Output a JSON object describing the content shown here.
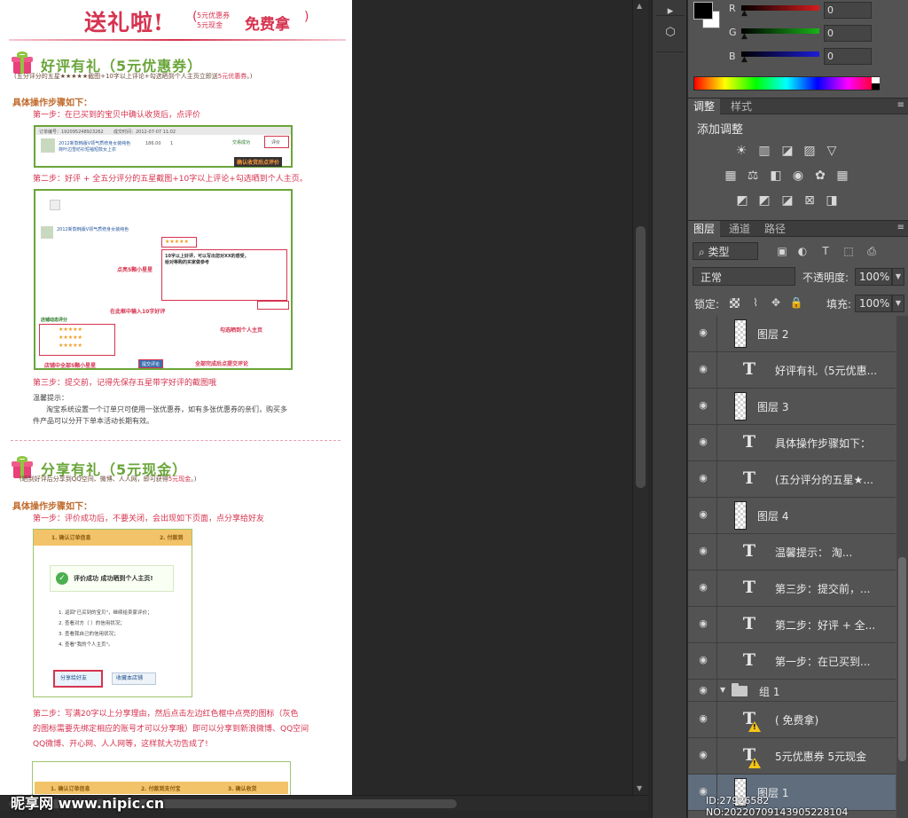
{
  "doc": {
    "header": {
      "title": "送礼啦!",
      "sub1": "5元优惠券",
      "sub2": "5元现金",
      "free": "免费拿",
      "paren_open": "(",
      "paren_close": ")"
    },
    "section1": {
      "title": "好评有礼（5元优惠券）",
      "note_a": "(五分评分的五星★★★★★截图+10字以上评论+勾选晒到个人主页立即送",
      "note_hl": "5元优惠券",
      "note_b": "。)",
      "steps_heading": "具体操作步骤如下：",
      "step1": "第一步：在已买到的宝贝中确认收货后，点评价",
      "step2": "第二步：好评 + 全五分评分的五星截图+10字以上评论+勾选晒到个人主页。",
      "step3": "第三步：提交前，记得先保存五星带字好评的截图哦",
      "tip_head": "温馨提示：",
      "tip_body1": "淘宝系统设置一个订单只可使用一张优惠券，如有多张优惠券的亲们，购买多",
      "tip_body2": "件产品可以分开下单本活动长期有效。"
    },
    "shot1": {
      "order_no": "订单编号：192095248923262",
      "deal_time": "成交时间：2012-07-07 11:02",
      "item": "2012新款韩版V领气质修身女装纯色",
      "item2": "荷叶边雪纺衫短袖短款女上衣",
      "price": "186.00",
      "qty": "1",
      "status": "交易成功",
      "rate_btn": "评价",
      "callout": "确认收货后点评价"
    },
    "shot2": {
      "callout_stars": "点亮5颗小星星",
      "callout_box": "在此框中输入10字好评",
      "callout_check": "勾选晒到个人主页",
      "callout_shop": "店铺中全部5颗小星星",
      "callout_submit": "全部完成后点提交评论",
      "review_text": "10字以上好评，可以写出您对XX的感受，",
      "review_text2": "给对等购的买家做参考",
      "submit_btn": "提交评论",
      "shop_rating": "店铺动态评分"
    },
    "section2": {
      "title": "分享有礼（5元现金）",
      "note_a": "(晒到好评后分享到QQ空间、微博、人人网，即可获得",
      "note_hl": "5元现金",
      "note_b": "。)",
      "steps_heading": "具体操作步骤如下：",
      "step1": "第一步：评价成功后，不要关闭，会出现如下页面，点分享给好友",
      "step2_l1": "第二步：写满20字以上分享理由，然后点击左边红色框中点亮的图标（灰色",
      "step2_l2": "的图标需要先绑定相应的账号才可以分享哦）即可以分享到新浪微博、QQ空间",
      "step2_l3": "QQ微博、开心网、人人网等，这样就大功告成了!"
    },
    "shot_share": {
      "bar1": "1. 确认订单信息",
      "bar2": "2. 付款到",
      "ok": "评价成功 成功晒到个人主页!",
      "list1": "1. 返回\"已买到的宝贝\"，继续给卖家评价；",
      "list2": "2. 查看对方（                ）的信用状况；",
      "list3": "3. 查看我自己的信用状况；",
      "list4": "4. 查看\"我的个人主页\"。",
      "share_btn": "分享给好友",
      "fav_btn": "收藏本店铺"
    },
    "shot3": {
      "bar1": "1. 确认订单信息",
      "bar2": "2. 付款到支付宝",
      "bar3": "3. 确认收货"
    }
  },
  "strip": {
    "icon1": "▸",
    "icon2": "⬡"
  },
  "color_panel": {
    "channels": [
      {
        "label": "R",
        "value": "0"
      },
      {
        "label": "G",
        "value": "0"
      },
      {
        "label": "B",
        "value": "0"
      }
    ],
    "colors": {
      "r": "#d81b1b",
      "g": "#18b418",
      "b": "#1c1cd6"
    }
  },
  "adjustments": {
    "tabs": [
      "调整",
      "样式"
    ],
    "heading": "添加调整",
    "icons_row1": [
      "☀",
      "▥",
      "◪",
      "▨",
      "▽"
    ],
    "icons_row2": [
      "▦",
      "⚖",
      "◧",
      "◉",
      "✿",
      "▦"
    ],
    "icons_row3": [
      "◩",
      "◩",
      "◪",
      "⊠",
      "◨"
    ]
  },
  "layers_panel": {
    "tabs": [
      "图层",
      "通道",
      "路径"
    ],
    "filter_kind": "⌕ 类型",
    "filter_icons": [
      "▣",
      "◐",
      "T",
      "⬚",
      "⎙"
    ],
    "blend_mode": "正常",
    "opacity_label": "不透明度:",
    "opacity_value": "100%",
    "lock_label": "锁定:",
    "lock_icons": [
      "⌇",
      "✥",
      "🔒"
    ],
    "fill_label": "填充:",
    "fill_value": "100%",
    "layers": [
      {
        "type": "image",
        "name": "图层 2"
      },
      {
        "type": "text",
        "name": "好评有礼（5元优惠..."
      },
      {
        "type": "image",
        "name": "图层 3"
      },
      {
        "type": "text",
        "name": "具体操作步骤如下："
      },
      {
        "type": "text",
        "name": "(五分评分的五星★..."
      },
      {
        "type": "image",
        "name": "图层 4"
      },
      {
        "type": "text",
        "name": "温馨提示：    淘..."
      },
      {
        "type": "text",
        "name": "第三步：提交前，..."
      },
      {
        "type": "text",
        "name": "第二步：好评 + 全..."
      },
      {
        "type": "text",
        "name": "第一步：在已买到..."
      },
      {
        "type": "group",
        "name": "组 1"
      },
      {
        "type": "text-warn",
        "name": "(        免费拿)"
      },
      {
        "type": "text-warn",
        "name": "5元优惠券 5元现金"
      },
      {
        "type": "image-selected",
        "name": "图层 1"
      }
    ]
  },
  "watermark": {
    "logo": "昵享网 www.nipic.cn",
    "id": "ID:27926582 NO:20220709143905228104"
  }
}
